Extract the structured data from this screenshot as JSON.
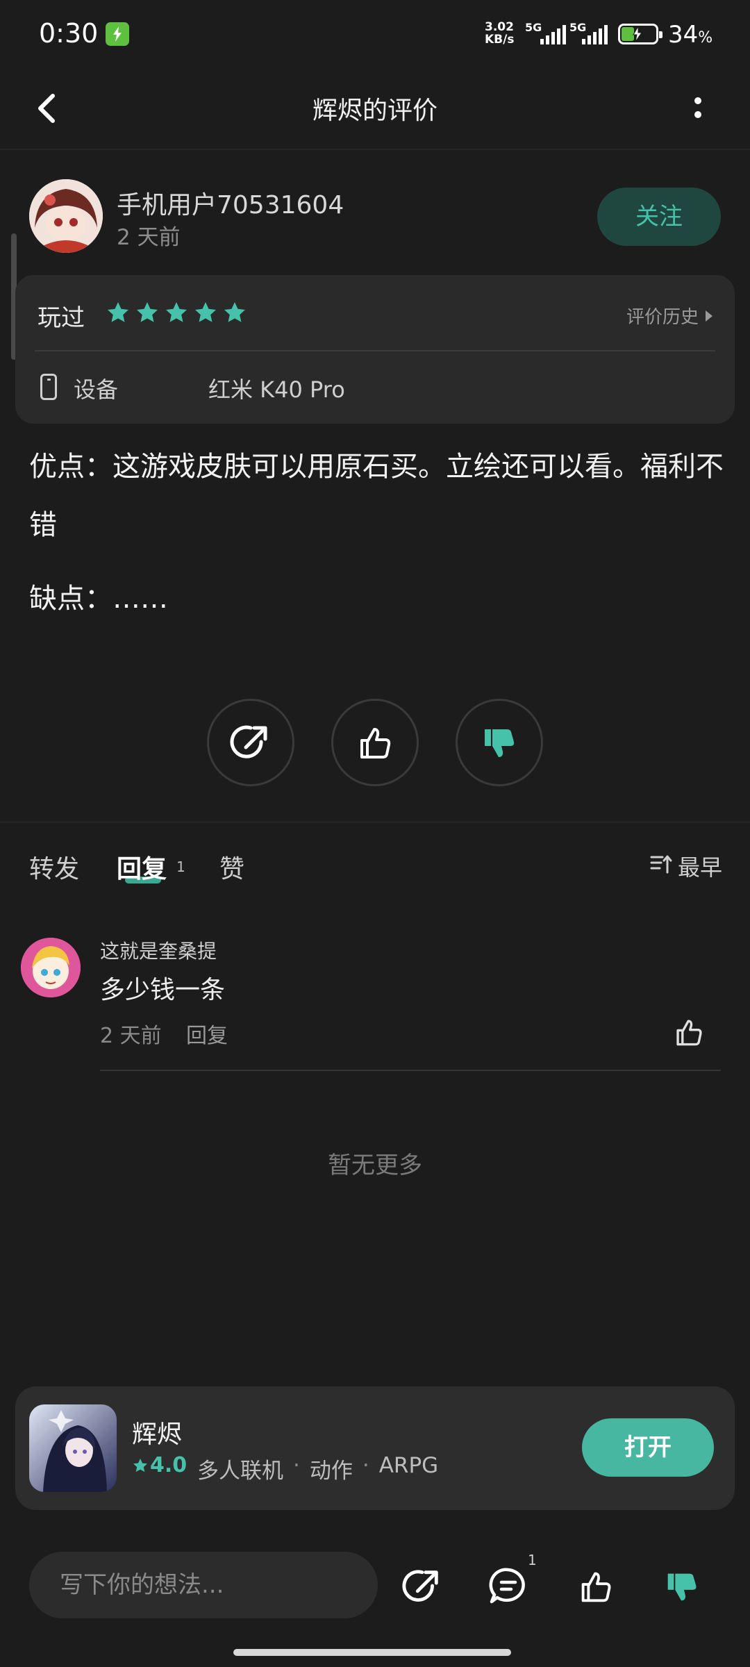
{
  "status_bar": {
    "time": "0:30",
    "net_speed_value": "3.02",
    "net_speed_unit": "KB/s",
    "sim1": "5G",
    "sim2": "5G",
    "battery": "34",
    "battery_unit": "%"
  },
  "header": {
    "title": "辉烬的评价"
  },
  "author": {
    "name": "手机用户70531604",
    "time": "2 天前",
    "follow_label": "关注"
  },
  "rating_card": {
    "played_label": "玩过",
    "stars": 5,
    "history_label": "评价历史",
    "device_label": "设备",
    "device_value": "红米 K40 Pro"
  },
  "review": {
    "pros": "优点：这游戏皮肤可以用原石买。立绘还可以看。福利不错",
    "cons": "缺点：……"
  },
  "tabs": {
    "repost": "转发",
    "reply": "回复",
    "reply_count": "1",
    "like": "赞",
    "sort": "最早"
  },
  "replies": [
    {
      "user": "这就是奎桑提",
      "text": "多少钱一条",
      "time": "2 天前",
      "reply_label": "回复"
    }
  ],
  "no_more": "暂无更多",
  "game": {
    "name": "辉烬",
    "rating": "4.0",
    "tags": [
      "多人联机",
      "动作",
      "ARPG"
    ],
    "open_label": "打开"
  },
  "bottom_bar": {
    "input_placeholder": "写下你的想法...",
    "comment_count": "1"
  },
  "colors": {
    "accent": "#47c2aa",
    "background": "#1c1c1c",
    "card": "#2a2a2a"
  }
}
